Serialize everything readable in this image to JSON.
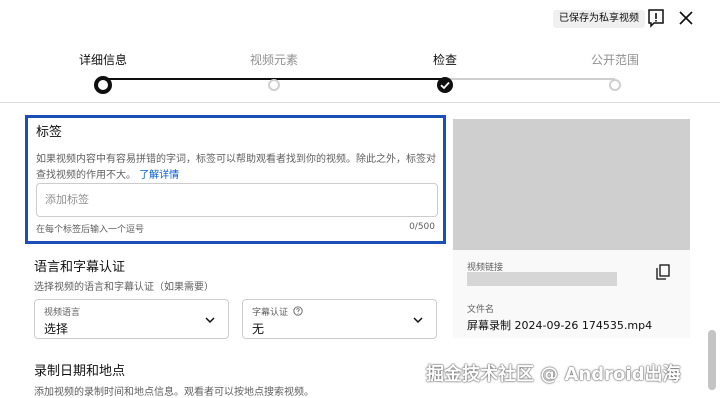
{
  "header": {
    "saved_label": "已保存为私享视频"
  },
  "stepper": {
    "steps": [
      {
        "label": "详细信息",
        "state": "current"
      },
      {
        "label": "视频元素",
        "state": "todo"
      },
      {
        "label": "检查",
        "state": "done"
      },
      {
        "label": "公开范围",
        "state": "todo"
      }
    ]
  },
  "tags": {
    "title": "标签",
    "description": "如果视频内容中有容易拼错的字词，标签可以帮助观看者找到你的视频。除此之外，标签对查找视频的作用不大。",
    "learn_more": "了解详情",
    "placeholder": "添加标签",
    "hint": "在每个标签后输入一个逗号",
    "counter": "0/500"
  },
  "language": {
    "title": "语言和字幕认证",
    "description": "选择视频的语言和字幕认证（如果需要）",
    "video_language_label": "视频语言",
    "video_language_value": "选择",
    "caption_cert_label": "字幕认证",
    "caption_cert_value": "无"
  },
  "recording": {
    "title": "录制日期和地点",
    "description": "添加视频的录制时间和地点信息。观看者可以按地点搜索视频。"
  },
  "video": {
    "link_label": "视频链接",
    "file_label": "文件名",
    "file_name": "屏幕录制 2024-09-26 174535.mp4"
  },
  "watermark": "掘金技术社区 @ Android出海",
  "colors": {
    "focus_border": "#1a4fb5",
    "link": "#065fd4"
  }
}
